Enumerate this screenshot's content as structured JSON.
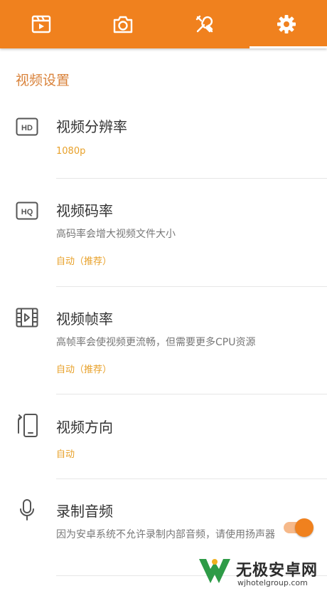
{
  "tabs": [
    {
      "name": "video",
      "icon": "clapperboard-icon"
    },
    {
      "name": "screenshot",
      "icon": "camera-icon"
    },
    {
      "name": "tools",
      "icon": "tools-icon"
    },
    {
      "name": "settings",
      "icon": "gear-icon",
      "selected": true
    }
  ],
  "colors": {
    "accent": "#f0811e",
    "value": "#e8a12a",
    "section": "#d9823a"
  },
  "section_title": "视频设置",
  "items": [
    {
      "title": "视频分辨率",
      "value": "1080p",
      "icon": "hd-icon"
    },
    {
      "title": "视频码率",
      "desc": "高码率会增大视频文件大小",
      "value": "自动（推荐）",
      "icon": "hq-icon"
    },
    {
      "title": "视频帧率",
      "desc": "高帧率会使视频更流畅，但需要更多CPU资源",
      "value": "自动（推荐）",
      "icon": "film-frame-icon"
    },
    {
      "title": "视频方向",
      "value": "自动",
      "icon": "rotate-phone-icon"
    },
    {
      "title": "录制音频",
      "desc": "因为安卓系统不允许录制内部音频，请使用扬声器",
      "toggle_on": true,
      "icon": "microphone-icon"
    }
  ],
  "watermark": {
    "text": "无极安卓网",
    "url": "wjhotelgroup.com"
  }
}
